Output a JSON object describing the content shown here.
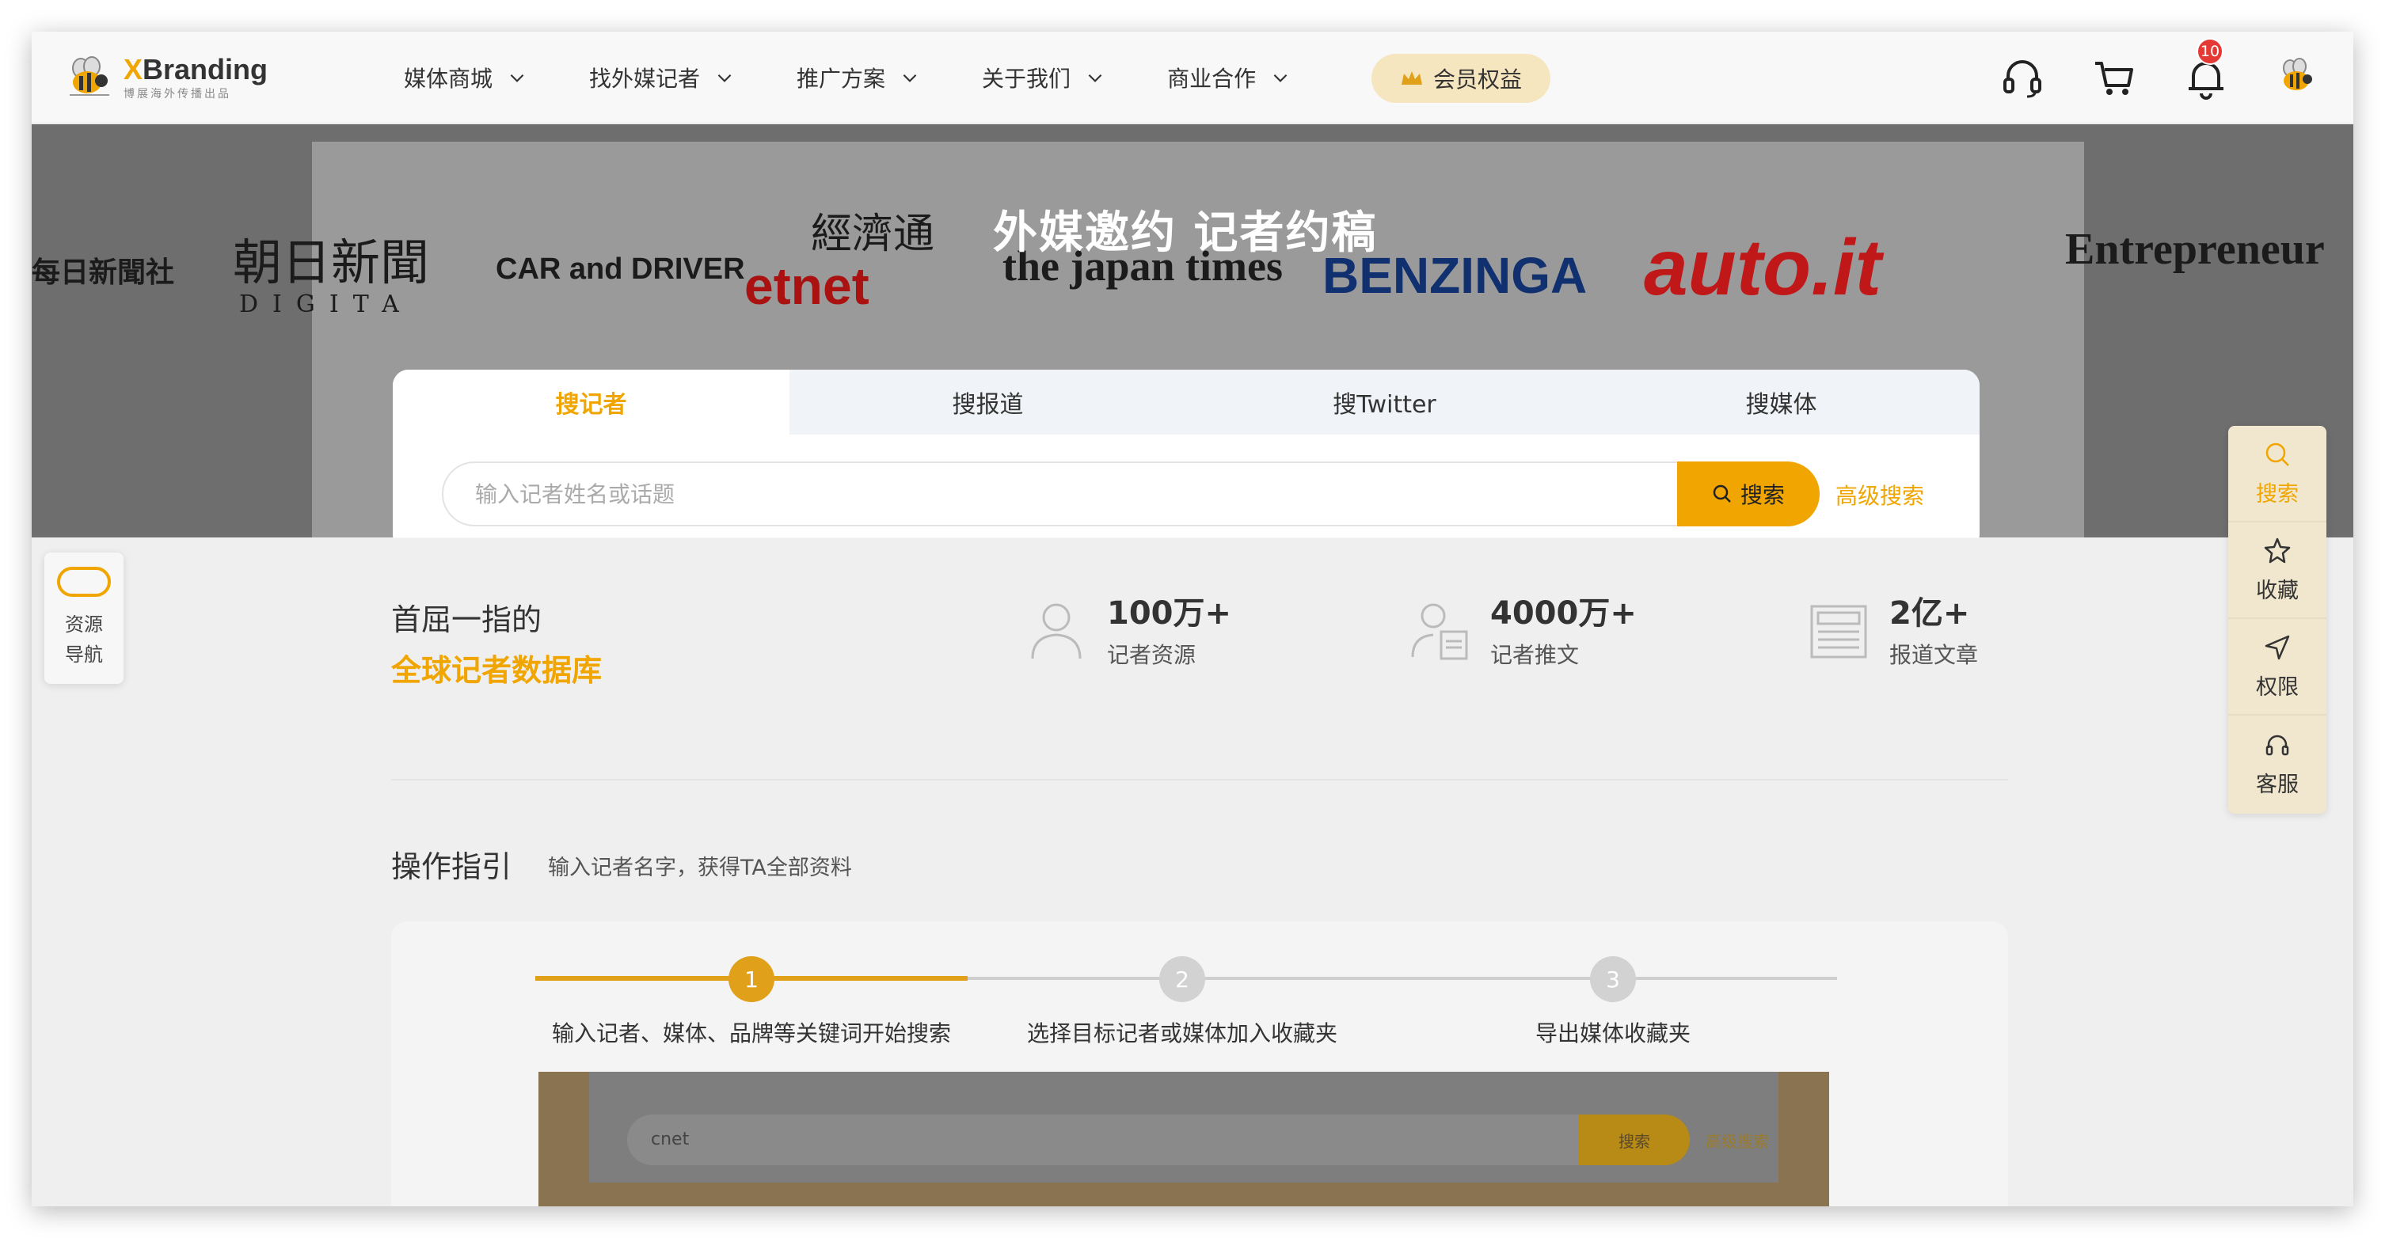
{
  "header": {
    "logo_main": "Branding",
    "logo_x": "X",
    "logo_sub": "博展海外传播出品",
    "nav": [
      {
        "label": "媒体商城"
      },
      {
        "label": "找外媒记者"
      },
      {
        "label": "推广方案"
      },
      {
        "label": "关于我们"
      },
      {
        "label": "商业合作"
      }
    ],
    "vip_label": "会员权益",
    "notification_count": "10",
    "icons": [
      "headset-icon",
      "cart-icon",
      "bell-icon",
      "avatar"
    ]
  },
  "hero": {
    "title": "外媒邀约  记者约稿",
    "media_logos": [
      "每日新聞社",
      "朝日新聞",
      "DIGITA",
      "CAR and DRIVER",
      "經濟通",
      "etnet",
      "the japan times",
      "BENZINGA",
      "auto.it",
      "Entrepreneur"
    ],
    "tabs": [
      {
        "label": "搜记者",
        "active": true
      },
      {
        "label": "搜报道",
        "active": false
      },
      {
        "label": "搜Twitter",
        "active": false
      },
      {
        "label": "搜媒体",
        "active": false
      }
    ],
    "search_placeholder": "输入记者姓名或话题",
    "search_button": "搜索",
    "advanced_search": "高级搜索"
  },
  "intro": {
    "line1": "首屈一指的",
    "line2": "全球记者数据库"
  },
  "stats": [
    {
      "value": "100万+",
      "label": "记者资源",
      "icon": "user-icon"
    },
    {
      "value": "4000万+",
      "label": "记者推文",
      "icon": "user-doc-icon"
    },
    {
      "value": "2亿+",
      "label": "报道文章",
      "icon": "newspaper-icon"
    }
  ],
  "guide": {
    "title": "操作指引",
    "subtitle": "输入记者名字，获得TA全部资料",
    "steps": [
      {
        "num": "1",
        "label": "输入记者、媒体、品牌等关键词开始搜索"
      },
      {
        "num": "2",
        "label": "选择目标记者或媒体加入收藏夹"
      },
      {
        "num": "3",
        "label": "导出媒体收藏夹"
      }
    ],
    "preview_input": "cnet",
    "preview_button": "搜索",
    "preview_adv": "高级搜索"
  },
  "left_float": {
    "line1": "资源",
    "line2": "导航"
  },
  "right_float": [
    {
      "label": "搜索",
      "icon": "search-icon"
    },
    {
      "label": "收藏",
      "icon": "star-icon"
    },
    {
      "label": "权限",
      "icon": "navigation-icon"
    },
    {
      "label": "客服",
      "icon": "headset-icon"
    }
  ],
  "colors": {
    "accent": "#f0a500",
    "badge": "#e53935",
    "vip_bg": "#f6e6bf"
  }
}
